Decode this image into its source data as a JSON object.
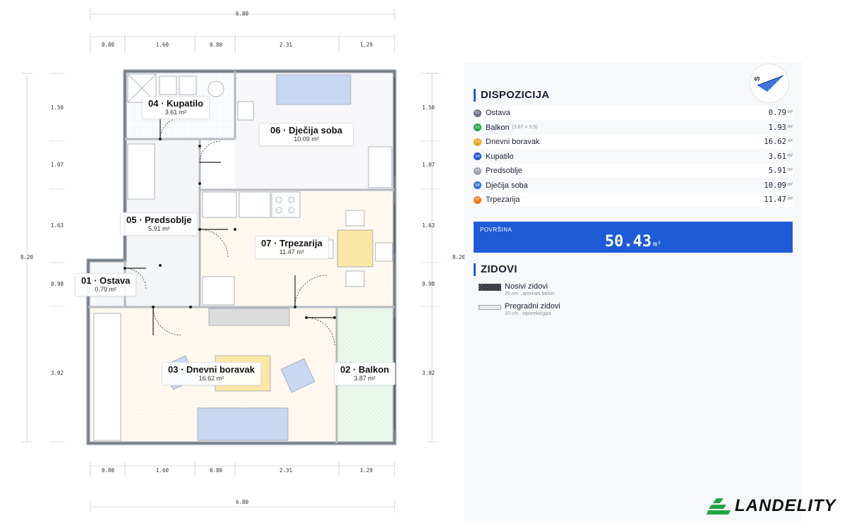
{
  "dimensions": {
    "overall_width": "6.80",
    "overall_height": "8.20",
    "segments_x": [
      "0.80",
      "1.60",
      "0.80",
      "2.31",
      "1.29"
    ],
    "segments_y": [
      "1.50",
      "1.07",
      "1.63",
      "0.98",
      "3.02"
    ]
  },
  "rooms": [
    {
      "name": "04 · Kupatilo",
      "area": "3.61 m²"
    },
    {
      "name": "06 · Dječija soba",
      "area": "10.09 m²"
    },
    {
      "name": "05 · Predsoblje",
      "area": "5.91 m²"
    },
    {
      "name": "07 · Trpezarija",
      "area": "11.47 m²"
    },
    {
      "name": "01 · Ostava",
      "area": "0.79 m²"
    },
    {
      "name": "03 · Dnevni boravak",
      "area": "16.62 m²"
    },
    {
      "name": "02 · Balkon",
      "area": "3.87 m²"
    }
  ],
  "compass": {
    "letter": "S"
  },
  "panel": {
    "disposition_title": "DISPOZICIJA",
    "unit": "m²",
    "items": [
      {
        "num": "01",
        "name": "Ostava",
        "note": "",
        "value": "0.79",
        "color": "#6b7280"
      },
      {
        "num": "02",
        "name": "Balkon",
        "note": "(3.87 × 0.5)",
        "value": "1.93",
        "color": "#22a447"
      },
      {
        "num": "03",
        "name": "Dnevni boravak",
        "note": "",
        "value": "16.62",
        "color": "#f0a01c"
      },
      {
        "num": "04",
        "name": "Kupatilo",
        "note": "",
        "value": "3.61",
        "color": "#1e5bd6"
      },
      {
        "num": "05",
        "name": "Predsoblje",
        "note": "",
        "value": "5.91",
        "color": "#9ca3af"
      },
      {
        "num": "06",
        "name": "Dječija soba",
        "note": "",
        "value": "10.09",
        "color": "#3b6fd8"
      },
      {
        "num": "07",
        "name": "Trpezarija",
        "note": "",
        "value": "11.47",
        "color": "#f07c1c"
      }
    ],
    "total_label": "POVRŠINA",
    "total_value": "50.43",
    "walls_title": "ZIDOVI",
    "walls": [
      {
        "name": "Nosivi zidovi",
        "spec": "25 cm · armirani beton"
      },
      {
        "name": "Pregradni zidovi",
        "spec": "10 cm · siporeks/gips"
      }
    ]
  },
  "brand": {
    "name": "LANDELITY",
    "color": "#22a447"
  }
}
